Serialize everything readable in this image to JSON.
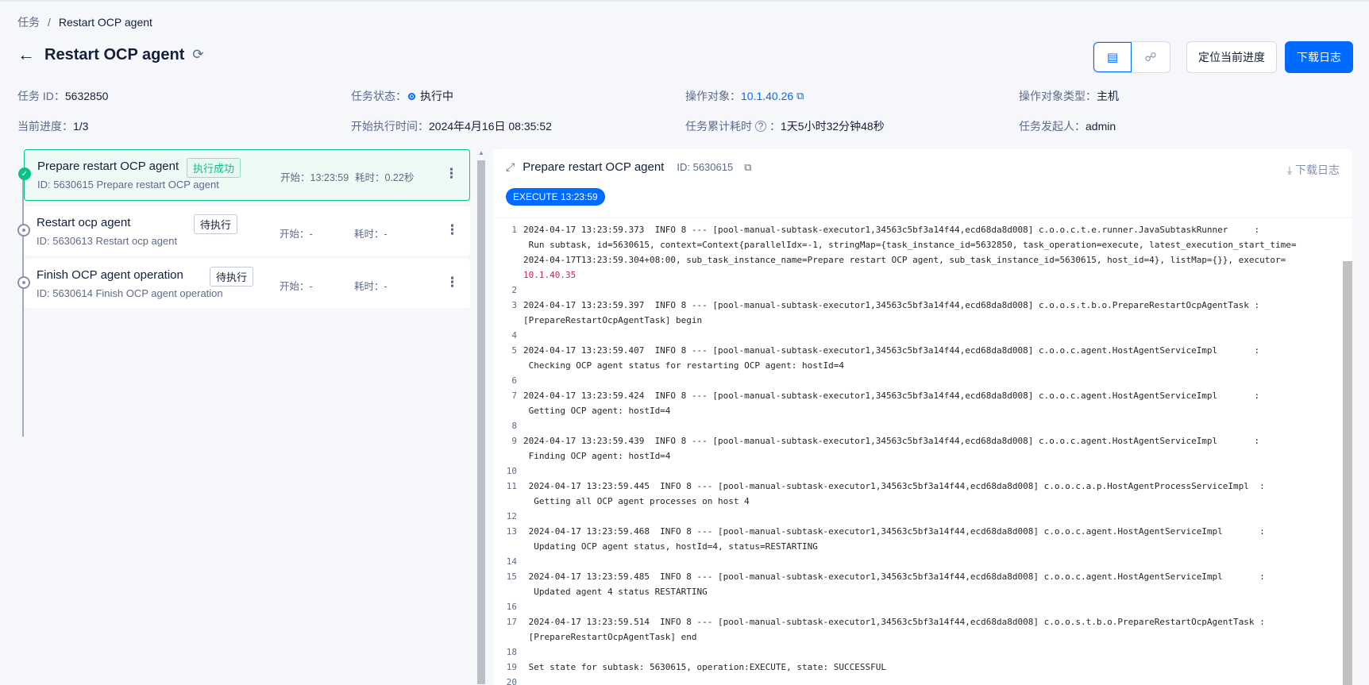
{
  "breadcrumb": {
    "parent": "任务",
    "separator": "/",
    "current": "Restart OCP agent"
  },
  "header": {
    "title": "Restart OCP agent",
    "locate_label": "定位当前进度",
    "download_label": "下载日志"
  },
  "icons": {
    "back": "arrow-left-icon",
    "refresh": "refresh-icon",
    "view_list": "list-view-icon",
    "view_tree": "tree-view-icon"
  },
  "info": {
    "task_id_label": "任务 ID：",
    "task_id": "5632850",
    "status_label": "任务状态：",
    "status": "执行中",
    "target_label": "操作对象：",
    "target": "10.1.40.26",
    "target_type_label": "操作对象类型：",
    "target_type": "主机",
    "progress_label": "当前进度：",
    "progress": "1/3",
    "start_label": "开始执行时间：",
    "start": "2024年4月16日 08:35:52",
    "elapsed_label": "任务累计耗时",
    "elapsed_colon": "：",
    "elapsed": "1天5小时32分钟48秒",
    "initiator_label": "任务发起人：",
    "initiator": "admin"
  },
  "tasks": [
    {
      "name": "Prepare restart OCP agent",
      "sub": "ID: 5630615  Prepare restart OCP agent",
      "badge": "执行成功",
      "start": "开始：13:23:59",
      "cost": "耗时：0.22秒"
    },
    {
      "name": "Restart ocp agent",
      "sub": "ID: 5630613  Restart ocp agent",
      "badge": "待执行",
      "start": "开始：-",
      "cost": "耗时：-"
    },
    {
      "name": "Finish OCP agent operation",
      "sub": "ID: 5630614  Finish OCP agent operation",
      "badge": "待执行",
      "start": "开始：-",
      "cost": "耗时：-"
    }
  ],
  "log": {
    "title": "Prepare restart OCP agent",
    "id": "ID: 5630615",
    "download": "下载日志",
    "pill": "EXECUTE 13:23:59",
    "lines": {
      "l1a": "2024-04-17 13:23:59.373  INFO 8 --- [pool-manual-subtask-executor1,34563c5bf3a14f44,ecd68da8d008] c.o.o.c.t.e.runner.JavaSubtaskRunner     :",
      "l1b": " Run subtask, id=5630615, context=Context{parallelIdx=-1, stringMap={task_instance_id=5632850, task_operation=execute, latest_execution_start_time=",
      "l1c": "2024-04-17T13:23:59.304+08:00, sub_task_instance_name=Prepare restart OCP agent, sub_task_instance_id=5630615, host_id=4}, listMap={}}, executor=",
      "l1d": "10.1.40.35",
      "l3a": "2024-04-17 13:23:59.397  INFO 8 --- [pool-manual-subtask-executor1,34563c5bf3a14f44,ecd68da8d008] c.o.o.s.t.b.o.PrepareRestartOcpAgentTask :",
      "l3b": "[PrepareRestartOcpAgentTask] begin",
      "l5a": "2024-04-17 13:23:59.407  INFO 8 --- [pool-manual-subtask-executor1,34563c5bf3a14f44,ecd68da8d008] c.o.o.c.agent.HostAgentServiceImpl       :",
      "l5b": " Checking OCP agent status for restarting OCP agent: hostId=4",
      "l7a": "2024-04-17 13:23:59.424  INFO 8 --- [pool-manual-subtask-executor1,34563c5bf3a14f44,ecd68da8d008] c.o.o.c.agent.HostAgentServiceImpl       :",
      "l7b": " Getting OCP agent: hostId=4",
      "l9a": "2024-04-17 13:23:59.439  INFO 8 --- [pool-manual-subtask-executor1,34563c5bf3a14f44,ecd68da8d008] c.o.o.c.agent.HostAgentServiceImpl       :",
      "l9b": " Finding OCP agent: hostId=4",
      "l11a": " 2024-04-17 13:23:59.445  INFO 8 --- [pool-manual-subtask-executor1,34563c5bf3a14f44,ecd68da8d008] c.o.o.c.a.p.HostAgentProcessServiceImpl  :",
      "l11b": "  Getting all OCP agent processes on host 4",
      "l13a": " 2024-04-17 13:23:59.468  INFO 8 --- [pool-manual-subtask-executor1,34563c5bf3a14f44,ecd68da8d008] c.o.o.c.agent.HostAgentServiceImpl       :",
      "l13b": "  Updating OCP agent status, hostId=4, status=RESTARTING",
      "l15a": " 2024-04-17 13:23:59.485  INFO 8 --- [pool-manual-subtask-executor1,34563c5bf3a14f44,ecd68da8d008] c.o.o.c.agent.HostAgentServiceImpl       :",
      "l15b": "  Updated agent 4 status RESTARTING",
      "l17a": " 2024-04-17 13:23:59.514  INFO 8 --- [pool-manual-subtask-executor1,34563c5bf3a14f44,ecd68da8d008] c.o.o.s.t.b.o.PrepareRestartOcpAgentTask :",
      "l17b": " [PrepareRestartOcpAgentTask] end",
      "l19": " Set state for subtask: 5630615, operation:EXECUTE, state: SUCCESSFUL"
    }
  }
}
